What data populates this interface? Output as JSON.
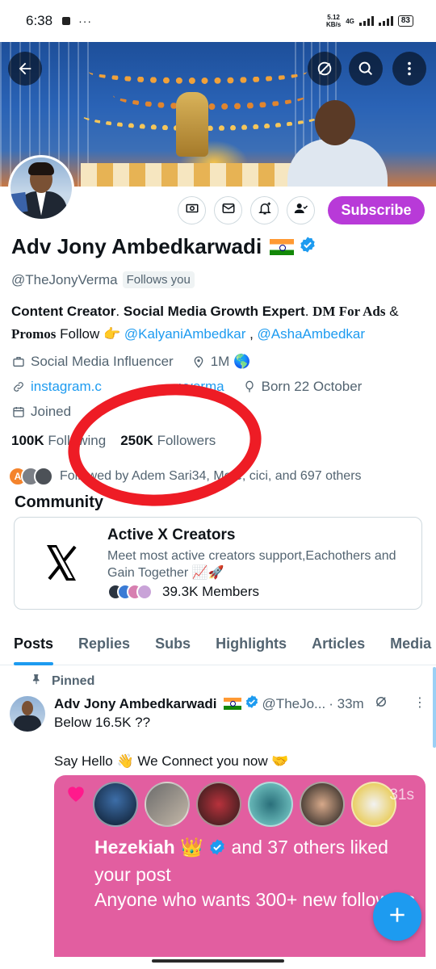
{
  "status_bar": {
    "time": "6:38",
    "overflow": "···",
    "speed_value": "5.12",
    "speed_unit": "KB/s",
    "network": "4G",
    "battery": "83"
  },
  "banner": {
    "back_icon": "arrow-left-icon",
    "grok_icon": "grok-icon",
    "search_icon": "search-icon",
    "more_icon": "more-vertical-icon"
  },
  "actions": {
    "subscribe_label": "Subscribe"
  },
  "profile": {
    "name": "Adv Jony Ambedkarwadi",
    "flag": "🇮🇳",
    "handle": "@TheJonyVerma",
    "follows_you": "Follows you",
    "bio": {
      "part1": "Content Creator",
      "part2": ". ",
      "part3": "Social Media Growth Expert",
      "part4": ". ",
      "part5": "DM For Ads",
      "part6": " & ",
      "part7": "Promos",
      "part8": "  Follow 👉 ",
      "mention1": "@KalyaniAmbedkar",
      "part9": " , ",
      "mention2": "@AshaAmbedkar"
    },
    "category": "Social Media Influencer",
    "location": "1M 🌎",
    "website": "instagram.com/thejonyverma",
    "website_visible_start": "instagram.c",
    "website_visible_end": "yverma",
    "born": "Born 22 October",
    "joined": "Joined",
    "following_count": "100K",
    "following_label": "Following",
    "followers_count": "250K",
    "followers_label": "Followers",
    "followed_by_initial": "A",
    "followed_by": "Followed by Adem Sari34, Mo     e, cici, and 697 others"
  },
  "community": {
    "section_title": "Community",
    "name": "Active X Creators",
    "description": "Meet most active creators support,Eachothers and Gain Together 📈🚀",
    "members": "39.3K Members"
  },
  "tabs": [
    "Posts",
    "Replies",
    "Subs",
    "Highlights",
    "Articles",
    "Media"
  ],
  "post": {
    "pinned_label": "Pinned",
    "author": "Adv Jony Ambedkarwadi",
    "flag": "🇮🇳",
    "handle": "@TheJo...",
    "time": "· 33m",
    "line1": "Below 16.5K ??",
    "line2": "Say Hello 👋 We Connect you now 🤝",
    "media": {
      "time": "31s",
      "liker": "Hezekiah 👑",
      "liked_text": " and 37 others liked your post",
      "line2": "Anyone who wants 300+ new followers"
    }
  },
  "colors": {
    "accent": "#1d9bf0",
    "subscribe": "#b83ad8",
    "annotation_circle": "#ee1c25",
    "media_bg": "#e25ea0"
  }
}
